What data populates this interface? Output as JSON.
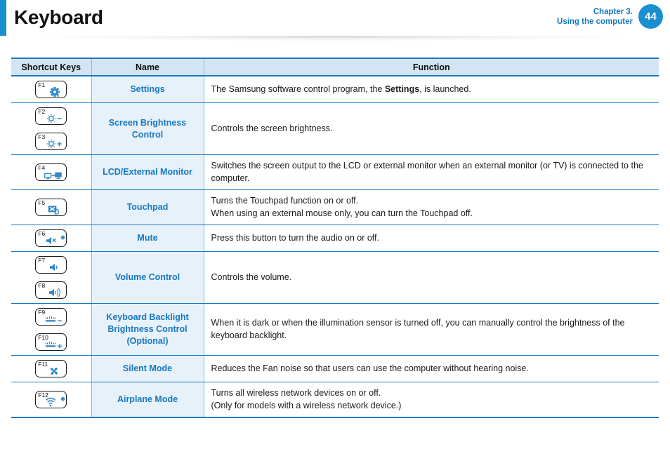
{
  "header": {
    "title": "Keyboard",
    "chapter_line1": "Chapter 3.",
    "chapter_line2": "Using the computer",
    "page_number": "44",
    "accent_color": "#1a8fd0",
    "link_color": "#1678c2"
  },
  "table": {
    "columns": [
      "Shortcut Keys",
      "Name",
      "Function"
    ],
    "rows": [
      {
        "keys": [
          {
            "label": "F1",
            "icon": "settings-gear-icon",
            "indicator": false
          }
        ],
        "name": "Settings",
        "function_lines": [
          {
            "parts": [
              {
                "text": "The Samsung software control program, the ",
                "bold": false
              },
              {
                "text": "Settings",
                "bold": true
              },
              {
                "text": ", is launched.",
                "bold": false
              }
            ]
          }
        ]
      },
      {
        "keys": [
          {
            "label": "F2",
            "icon": "brightness-down-icon",
            "indicator": false
          },
          {
            "label": "F3",
            "icon": "brightness-up-icon",
            "indicator": false
          }
        ],
        "name": "Screen Brightness Control",
        "function_lines": [
          {
            "parts": [
              {
                "text": "Controls the screen brightness.",
                "bold": false
              }
            ]
          }
        ]
      },
      {
        "keys": [
          {
            "label": "F4",
            "icon": "external-monitor-icon",
            "indicator": false
          }
        ],
        "name": "LCD/External Monitor",
        "function_lines": [
          {
            "parts": [
              {
                "text": "Switches the screen output to the LCD or external monitor when an external monitor (or TV) is connected to the computer.",
                "bold": false
              }
            ]
          }
        ]
      },
      {
        "keys": [
          {
            "label": "F5",
            "icon": "touchpad-off-icon",
            "indicator": false
          }
        ],
        "name": "Touchpad",
        "function_lines": [
          {
            "parts": [
              {
                "text": "Turns the Touchpad function on or off.",
                "bold": false
              }
            ]
          },
          {
            "parts": [
              {
                "text": "When using an external mouse only, you can turn the Touchpad off.",
                "bold": false
              }
            ]
          }
        ]
      },
      {
        "keys": [
          {
            "label": "F6",
            "icon": "mute-speaker-icon",
            "indicator": true
          }
        ],
        "name": "Mute",
        "function_lines": [
          {
            "parts": [
              {
                "text": "Press this button to turn the audio on or off.",
                "bold": false
              }
            ]
          }
        ]
      },
      {
        "keys": [
          {
            "label": "F7",
            "icon": "volume-down-icon",
            "indicator": false
          },
          {
            "label": "F8",
            "icon": "volume-up-icon",
            "indicator": false
          }
        ],
        "name": "Volume Control",
        "function_lines": [
          {
            "parts": [
              {
                "text": "Controls the volume.",
                "bold": false
              }
            ]
          }
        ]
      },
      {
        "keys": [
          {
            "label": "F9",
            "icon": "keyboard-backlight-down-icon",
            "indicator": false
          },
          {
            "label": "F10",
            "icon": "keyboard-backlight-up-icon",
            "indicator": false
          }
        ],
        "name": "Keyboard Backlight Brightness Control (Optional)",
        "function_lines": [
          {
            "parts": [
              {
                "text": "When it is dark or when the illumination sensor is turned off, you can manually control the brightness of the keyboard backlight.",
                "bold": false
              }
            ]
          }
        ]
      },
      {
        "keys": [
          {
            "label": "F11",
            "icon": "fan-icon",
            "indicator": false
          }
        ],
        "name": "Silent Mode",
        "function_lines": [
          {
            "parts": [
              {
                "text": "Reduces the Fan noise so that users can use the computer without hearing noise.",
                "bold": false
              }
            ]
          }
        ]
      },
      {
        "keys": [
          {
            "label": "F12",
            "icon": "wireless-icon",
            "indicator": true
          }
        ],
        "name": "Airplane Mode",
        "function_lines": [
          {
            "parts": [
              {
                "text": "Turns all wireless network devices on or off.",
                "bold": false
              }
            ]
          },
          {
            "parts": [
              {
                "text": "(Only for models with a wireless network device.)",
                "bold": false
              }
            ]
          }
        ]
      }
    ]
  }
}
